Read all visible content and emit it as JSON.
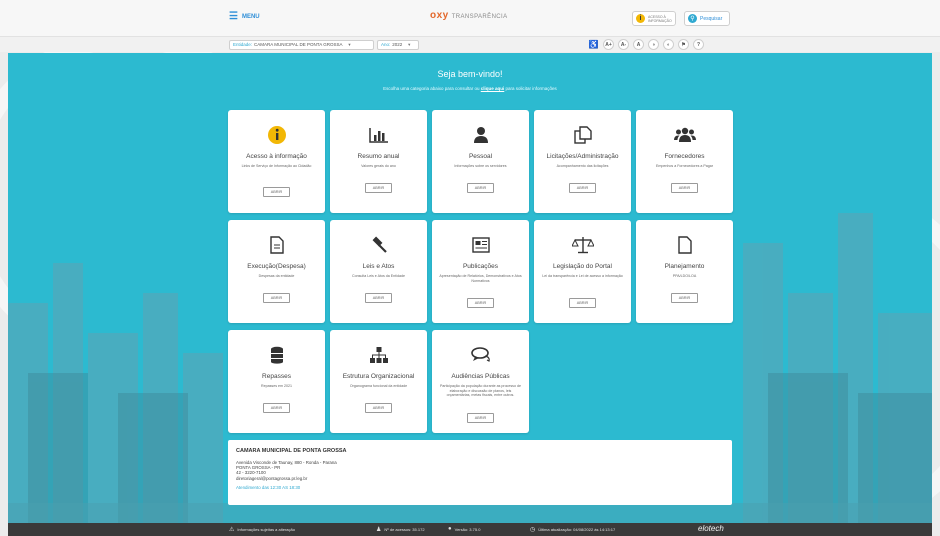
{
  "header": {
    "menu_label": "MENU",
    "brand_oxy": "oxy",
    "brand_sub": "TRANSPARÊNCIA",
    "access_label": "ACESSO À INFORMAÇÃO",
    "search_label": "Pesquisar"
  },
  "filters": {
    "entity_label": "Entidade:",
    "entity_value": "CAMARA MUNICIPAL DE PONTA GROSSA",
    "year_label": "Ano:",
    "year_value": "2022"
  },
  "tools": [
    "♿",
    "A+",
    "A-",
    "A",
    "◑",
    "◐",
    "⚑",
    "?"
  ],
  "welcome": {
    "title": "Seja bem-vindo!",
    "subtitle_before": "Escolha uma categoria abaixo para consultar ou",
    "subtitle_link": "clique aqui",
    "subtitle_after": "para solicitar informações"
  },
  "open_label": "ABRIR",
  "cards": [
    {
      "title": "Acesso à informação",
      "desc": "Links de Serviço de Informação ao Cidadão",
      "icon": "info-icon"
    },
    {
      "title": "Resumo anual",
      "desc": "Valores gerais do ano",
      "icon": "bar-chart-icon"
    },
    {
      "title": "Pessoal",
      "desc": "Informações sobre os servidores",
      "icon": "user-icon"
    },
    {
      "title": "Licitações/Administração",
      "desc": "Acompanhamento das licitações",
      "icon": "documents-icon"
    },
    {
      "title": "Fornecedores",
      "desc": "Empenhos a Fornecedores a Pagar",
      "icon": "users-icon"
    },
    {
      "title": "Execução(Despesa)",
      "desc": "Despesas da entidade",
      "icon": "file-icon"
    },
    {
      "title": "Leis e Atos",
      "desc": "Consulta Leis e Atos da Entidade",
      "icon": "gavel-icon"
    },
    {
      "title": "Publicações",
      "desc": "Apresentação de Relatórios, Demonstrativos e Atos Normativos",
      "icon": "newspaper-icon"
    },
    {
      "title": "Legislação do Portal",
      "desc": "Lei da transparência e Lei de acesso a informação",
      "icon": "scale-icon"
    },
    {
      "title": "Planejamento",
      "desc": "PPA/LDO/LOA",
      "icon": "blank-file-icon"
    },
    {
      "title": "Repasses",
      "desc": "Repasses em 2021",
      "icon": "database-icon"
    },
    {
      "title": "Estrutura Organizacional",
      "desc": "Organograma funcional da entidade",
      "icon": "sitemap-icon"
    },
    {
      "title": "Audiências Públicas",
      "desc": "Participação da população durante as processo de elaboração e discussão de planos, leis orçamentárias, metas fiscais, entre outros.",
      "icon": "comments-icon"
    }
  ],
  "info": {
    "name": "CAMARA MUNICIPAL DE PONTA GROSSA",
    "address": "Avenida Visconde de Taunay, 880 - Ronda - Parana",
    "city": "PONTA GROSSA - PR",
    "phone": "42 - 3220-7100",
    "email": "diretoriageral@pontagrossa.pr.leg.br",
    "hours": "Atendimento das 12:30 AS 18:30"
  },
  "footer": {
    "info_label": "Informações sujeitas a alteração",
    "visits": "Nº de acessos: 35.172",
    "version": "Versão: 3.75.0",
    "last_update": "Última atualização: 04/08/2022 às 14:13:17",
    "vendor": "elotech"
  },
  "colors": {
    "teal": "#2cbad0",
    "brand_orange": "#e3682b",
    "accent_blue": "#2f8fd8"
  }
}
